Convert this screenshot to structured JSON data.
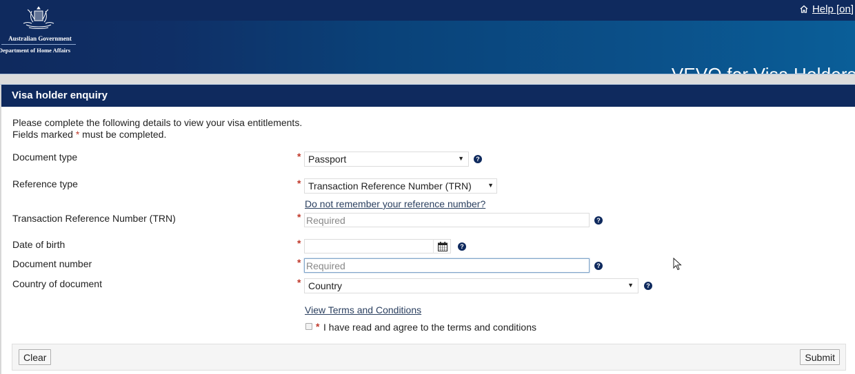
{
  "header": {
    "logo": {
      "line1": "Australian Government",
      "line2": "Department of Home Affairs"
    },
    "help_link": "Help [on]",
    "app_title": "VEVO for Visa Holders"
  },
  "panel": {
    "title": "Visa holder enquiry",
    "intro_line1": "Please complete the following details to view your visa entitlements.",
    "intro_line2_prefix": "Fields marked ",
    "intro_line2_star": "*",
    "intro_line2_suffix": " must be completed."
  },
  "form": {
    "required_marker": "*",
    "help_glyph": "?",
    "document_type": {
      "label": "Document type",
      "value": "Passport"
    },
    "reference_type": {
      "label": "Reference type",
      "value": "Transaction Reference Number (TRN)"
    },
    "forgot_reference_link": "Do not remember your reference number?",
    "trn": {
      "label": "Transaction Reference Number (TRN)",
      "value": "",
      "placeholder": "Required"
    },
    "date_of_birth": {
      "label": "Date of birth",
      "value": ""
    },
    "document_number": {
      "label": "Document number",
      "value": "",
      "placeholder": "Required"
    },
    "country_of_document": {
      "label": "Country of document",
      "value": "Country"
    },
    "terms_link": "View Terms and Conditions",
    "agree": {
      "label": "I have read and agree to the terms and conditions",
      "checked": false
    }
  },
  "actions": {
    "clear_label": "Clear",
    "submit_label": "Submit"
  },
  "colors": {
    "brand_navy": "#0f2a5e",
    "required_red": "#c0392b"
  }
}
